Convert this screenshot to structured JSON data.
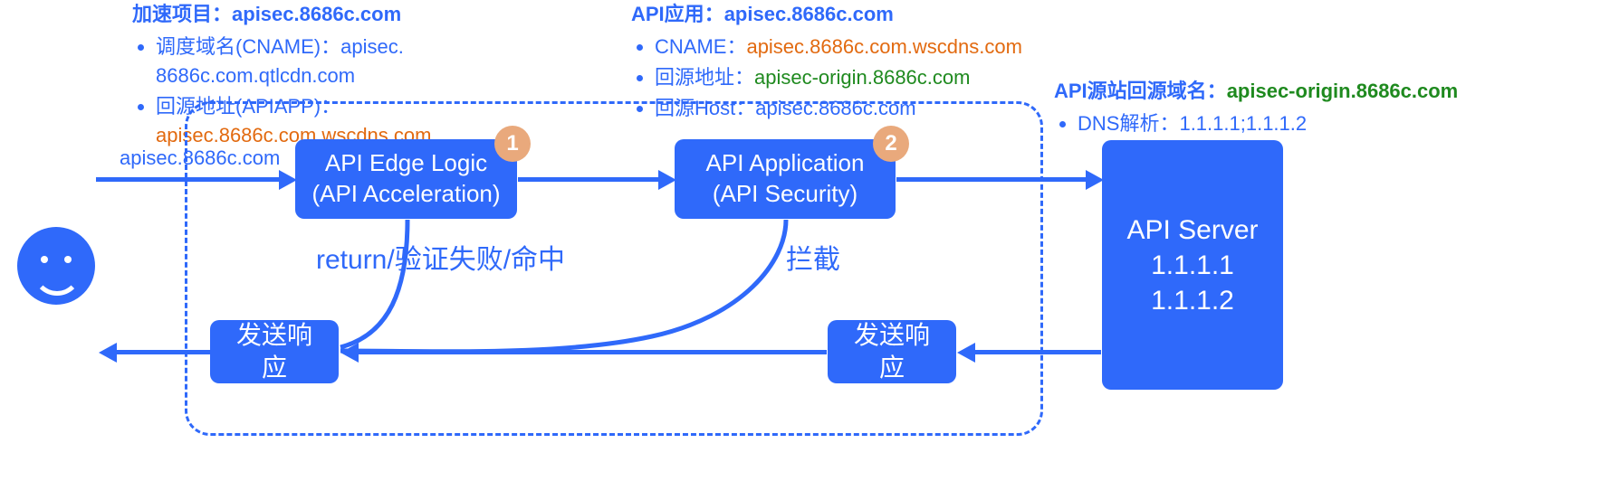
{
  "accel": {
    "title_pre": "加速项目：",
    "title_val": "apisec.8686c.com",
    "li1_pre": "调度域名(CNAME)：",
    "li1_val": "apisec. 8686c.com.qtlcdn.com",
    "li2_pre": "回源地址(APIAPP)：",
    "li2_val": "apisec.8686c.com.wscdns.com"
  },
  "apiapp": {
    "title_pre": "API应用：",
    "title_val": "apisec.8686c.com",
    "li1_pre": "CNAME：",
    "li1_val": "apisec.8686c.com.wscdns.com",
    "li2_pre": "回源地址：",
    "li2_val": "apisec-origin.8686c.com",
    "li3_pre": "回源Host：",
    "li3_val": "apisec.8686c.com"
  },
  "origin": {
    "title_pre": "API源站回源域名：",
    "title_val": "apisec-origin.8686c.com",
    "li1_pre": "DNS解析：",
    "li1_val": "1.1.1.1;1.1.1.2"
  },
  "labels": {
    "entry_domain": "apisec.8686c.com",
    "return_path": "return/验证失败/命中",
    "intercept": "拦截"
  },
  "nodes": {
    "edge_l1": "API Edge Logic",
    "edge_l2": "(API Acceleration)",
    "app_l1": "API Application",
    "app_l2": "(API Security)",
    "resp": "发送响应",
    "server_l1": "API Server",
    "server_l2": "1.1.1.1",
    "server_l3": "1.1.1.2",
    "badge1": "1",
    "badge2": "2"
  }
}
